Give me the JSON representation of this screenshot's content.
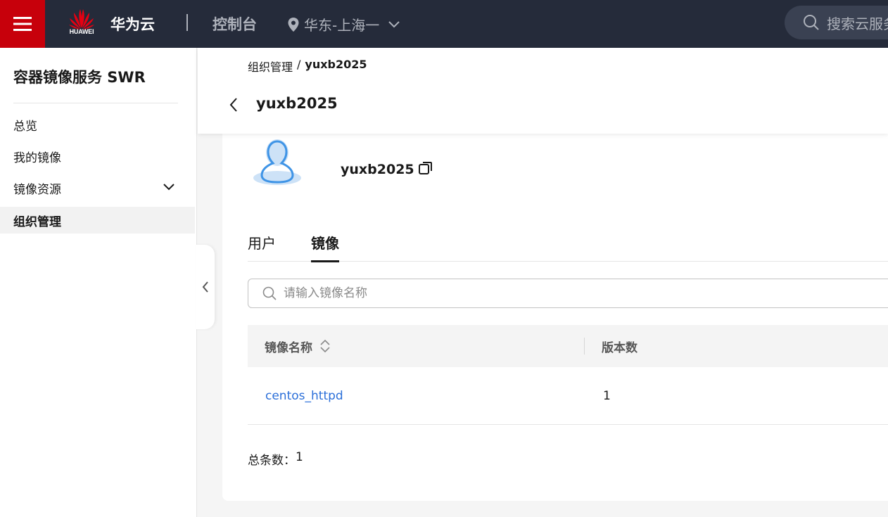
{
  "topbar": {
    "logo_text": "HUAWEI",
    "brand": "华为云",
    "console": "控制台",
    "region": "华东-上海一",
    "search_placeholder": "搜索云服务"
  },
  "sidebar": {
    "title": "容器镜像服务 SWR",
    "items": [
      {
        "label": "总览"
      },
      {
        "label": "我的镜像"
      },
      {
        "label": "镜像资源"
      },
      {
        "label": "组织管理"
      }
    ]
  },
  "header": {
    "breadcrumb": [
      "组织管理",
      "/",
      "yuxb2025"
    ],
    "title": "yuxb2025"
  },
  "org": {
    "name": "yuxb2025"
  },
  "tabs": [
    {
      "label": "用户"
    },
    {
      "label": "镜像"
    }
  ],
  "search": {
    "placeholder": "请输入镜像名称"
  },
  "table": {
    "columns": [
      "镜像名称",
      "版本数"
    ],
    "rows": [
      {
        "name": "centos_httpd",
        "versions": "1"
      }
    ]
  },
  "footer": {
    "total_label": "总条数：",
    "total_value": "1"
  },
  "colors": {
    "topbar_bg": "#252b3a",
    "menu_red": "#c7000b",
    "link_blue": "#2b6fd9",
    "avatar_blue": "#3f94e6"
  }
}
